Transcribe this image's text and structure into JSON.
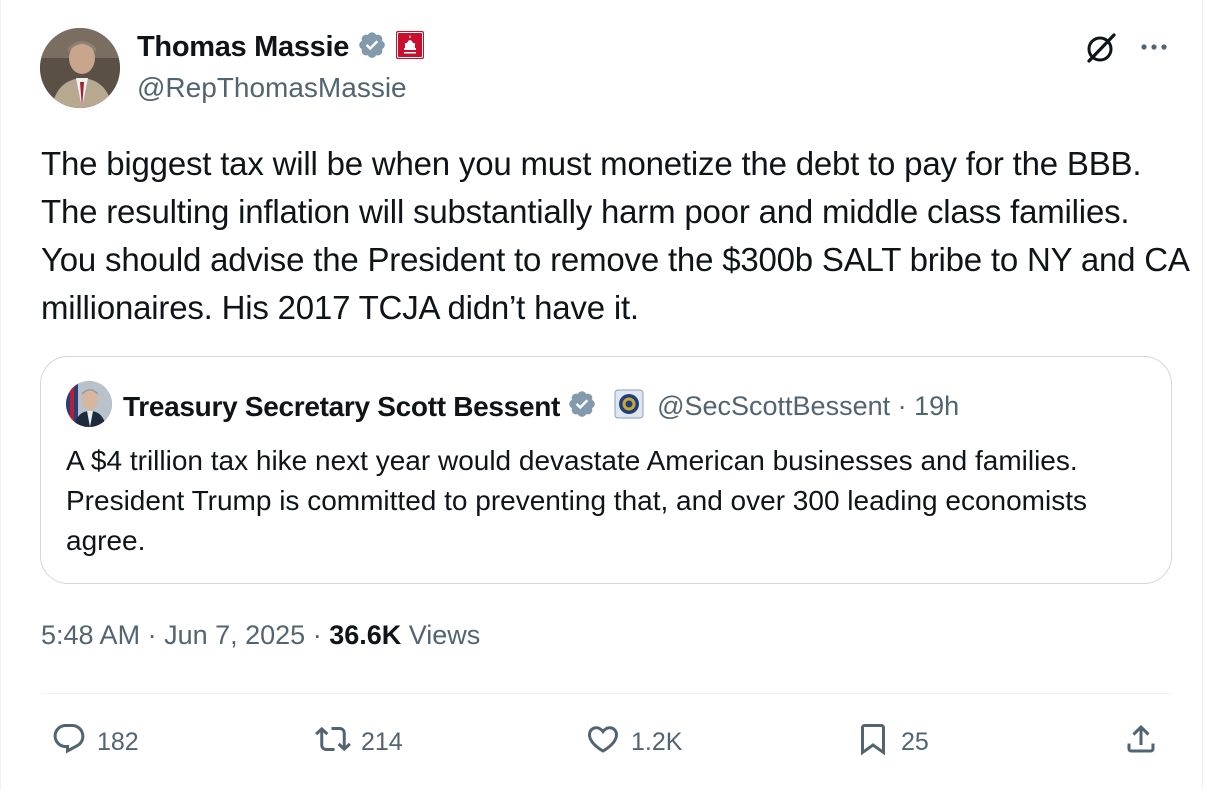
{
  "author": {
    "name": "Thomas Massie",
    "handle": "@RepThomasMassie"
  },
  "tweet": {
    "text": "The biggest tax will be when you must monetize the debt to pay for the BBB. The resulting inflation will substantially harm poor and middle class families. You should advise the President to remove the $300b SALT bribe to NY and CA millionaires. His 2017 TCJA didn’t have it."
  },
  "quote": {
    "name": "Treasury Secretary Scott Bessent",
    "handle": "@SecScottBessent",
    "separator": " · ",
    "time": "19h",
    "text": "A $4 trillion tax hike next year would devastate American businesses and families. President Trump is committed to preventing that, and over 300 leading economists agree."
  },
  "meta": {
    "time": "5:48 AM",
    "date": "Jun 7, 2025",
    "views_count": "36.6K",
    "views_label": "Views"
  },
  "actions": {
    "replies": "182",
    "reposts": "214",
    "likes": "1.2K",
    "bookmarks": "25"
  },
  "colors": {
    "verified": "#829aab",
    "text_secondary": "#536471",
    "border": "#cfd9de",
    "house_badge": "#c8102e"
  },
  "icons": [
    "verified-badge-icon",
    "house-badge-icon",
    "treasury-badge-icon",
    "grok-icon",
    "more-icon",
    "reply-icon",
    "repost-icon",
    "like-icon",
    "bookmark-icon",
    "share-icon"
  ]
}
